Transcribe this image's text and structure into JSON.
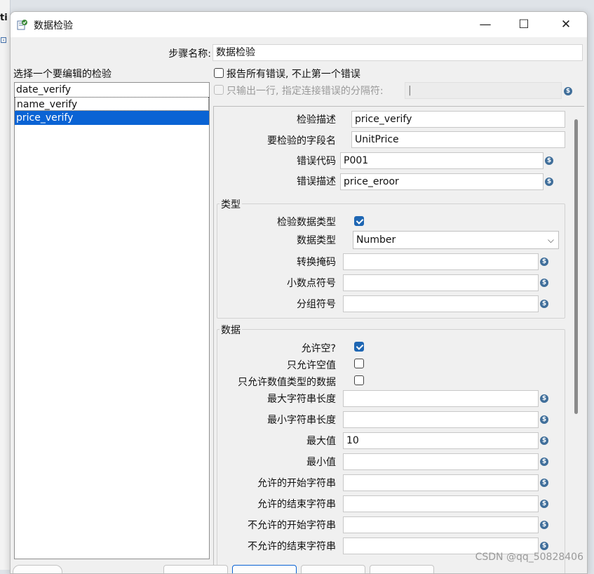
{
  "background": {
    "app_title_fragment": "ti",
    "icon_glyph": "⊡"
  },
  "window": {
    "title": "数据检验",
    "controls": {
      "minimize": "—",
      "maximize": "☐",
      "close": "✕"
    }
  },
  "step_name": {
    "label": "步骤名称:",
    "value": "数据检验"
  },
  "list_header": "选择一个要编辑的检验",
  "validators": [
    {
      "name": "date_verify"
    },
    {
      "name": "name_verify"
    },
    {
      "name": "price_verify"
    }
  ],
  "options": {
    "report_all_label": "报告所有错误, 不止第一个错误",
    "single_row_label": "只输出一行, 指定连接错误的分隔符:",
    "separator_value": "|"
  },
  "variable_icon": "$",
  "details": {
    "desc_label": "检验描述",
    "desc_value": "price_verify",
    "field_label": "要检验的字段名",
    "field_value": "UnitPrice",
    "error_code_label": "错误代码",
    "error_code_value": "P001",
    "error_desc_label": "错误描述",
    "error_desc_value": "price_eroor"
  },
  "type_group": {
    "title": "类型",
    "check_type_label": "检验数据类型",
    "data_type_label": "数据类型",
    "data_type_value": "Number",
    "chevron": "⌵",
    "mask_label": "转换掩码",
    "decimal_label": "小数点符号",
    "grouping_label": "分组符号"
  },
  "data_group": {
    "title": "数据",
    "allow_null_label": "允许空?",
    "only_null_label": "只允许空值",
    "only_numeric_label": "只允许数值类型的数据",
    "max_len_label": "最大字符串长度",
    "min_len_label": "最小字符串长度",
    "max_value_label": "最大值",
    "max_value": "10",
    "min_value_label": "最小值",
    "allowed_start_label": "允许的开始字符串",
    "allowed_end_label": "允许的结束字符串",
    "disallowed_start_label": "不允许的开始字符串",
    "disallowed_end_label": "不允许的结束字符串"
  },
  "watermark": "CSDN @qq_50828406"
}
